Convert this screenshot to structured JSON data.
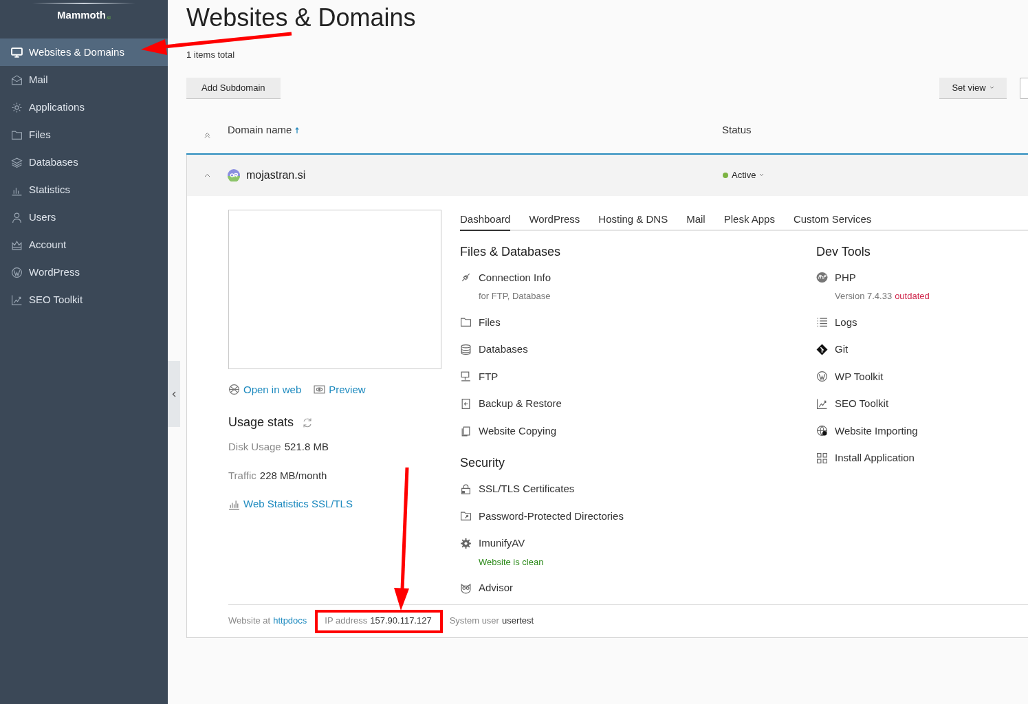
{
  "sidebar": {
    "logo": "Mammoth",
    "logo_suffix": ".si",
    "items": [
      {
        "label": "Websites & Domains",
        "selected": true
      },
      {
        "label": "Mail",
        "selected": false
      },
      {
        "label": "Applications",
        "selected": false
      },
      {
        "label": "Files",
        "selected": false
      },
      {
        "label": "Databases",
        "selected": false
      },
      {
        "label": "Statistics",
        "selected": false
      },
      {
        "label": "Users",
        "selected": false
      },
      {
        "label": "Account",
        "selected": false
      },
      {
        "label": "WordPress",
        "selected": false
      },
      {
        "label": "SEO Toolkit",
        "selected": false
      }
    ]
  },
  "page": {
    "title": "Websites & Domains",
    "count": "1 items total"
  },
  "toolbar": {
    "add_button": "Add Subdomain",
    "set_view": "Set view"
  },
  "table": {
    "columns": [
      "Domain name",
      "Status"
    ],
    "rows": [
      {
        "domain": "mojastran.si",
        "status": "Active",
        "expanded": true
      }
    ]
  },
  "details": {
    "links": [
      "Open in web",
      "Preview"
    ],
    "usage": {
      "title": "Usage stats",
      "rows": [
        {
          "label": "Disk Usage",
          "value": "521.8 MB"
        },
        {
          "label": "Traffic",
          "value": "228 MB/month"
        }
      ],
      "link": "Web Statistics SSL/TLS"
    },
    "tabs": [
      {
        "label": "Dashboard",
        "selected": true
      },
      {
        "label": "WordPress",
        "selected": false
      },
      {
        "label": "Hosting & DNS",
        "selected": false
      },
      {
        "label": "Mail",
        "selected": false
      },
      {
        "label": "Plesk Apps",
        "selected": false
      },
      {
        "label": "Custom Services",
        "selected": false
      }
    ],
    "columns": [
      [
        {
          "title": "Files & Databases",
          "items": [
            {
              "label": "Connection Info",
              "note": {
                "text": "for FTP, Database",
                "kind": "muted"
              }
            },
            {
              "label": "Files"
            },
            {
              "label": "Databases"
            },
            {
              "label": "FTP"
            },
            {
              "label": "Backup & Restore"
            },
            {
              "label": "Website Copying"
            }
          ]
        },
        {
          "title": "Security",
          "items": [
            {
              "label": "SSL/TLS Certificates"
            },
            {
              "label": "Password-Protected Directories"
            },
            {
              "label": "ImunifyAV",
              "note": {
                "text": "Website is clean",
                "kind": "success"
              }
            },
            {
              "label": "Advisor"
            }
          ]
        }
      ],
      [
        {
          "title": "Dev Tools",
          "items": [
            {
              "label": "PHP",
              "note": {
                "text": "Version 7.4.33",
                "kind": "muted",
                "flag": "outdated"
              }
            },
            {
              "label": "Logs"
            },
            {
              "label": "Git"
            },
            {
              "label": "WP Toolkit"
            },
            {
              "label": "SEO Toolkit"
            },
            {
              "label": "Website Importing"
            },
            {
              "label": "Install Application"
            }
          ]
        }
      ]
    ],
    "footer": [
      {
        "label": "Website at",
        "value": "httpdocs",
        "kind": "link"
      },
      {
        "label": "IP address",
        "value": "157.90.117.127",
        "kind": "text"
      },
      {
        "label": "System user",
        "value": "usertest",
        "kind": "text"
      }
    ]
  }
}
